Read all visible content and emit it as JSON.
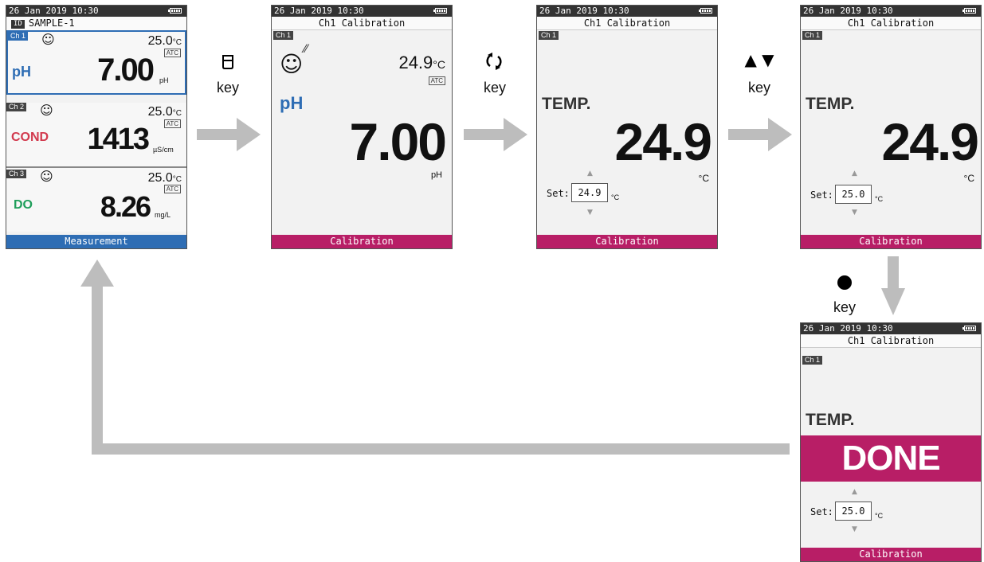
{
  "status_time": "26 Jan 2019  10:30",
  "screen1": {
    "id_tag": "ID",
    "sample": "SAMPLE-1",
    "channels": [
      {
        "tag": "Ch 1",
        "temp": "25.0",
        "temp_unit": "°C",
        "atc": "ATC",
        "param": "pH",
        "value": "7.00",
        "unit": "pH",
        "color": "#2e6db4"
      },
      {
        "tag": "Ch 2",
        "temp": "25.0",
        "temp_unit": "°C",
        "atc": "ATC",
        "param": "COND",
        "value": "1413",
        "unit": "µS/cm",
        "color": "#d23a4e"
      },
      {
        "tag": "Ch 3",
        "temp": "25.0",
        "temp_unit": "°C",
        "atc": "ATC",
        "param": "DO",
        "value": "8.26",
        "unit": "mg/L",
        "color": "#1e9e5a"
      }
    ],
    "footer": "Measurement"
  },
  "screen2": {
    "title": "Ch1 Calibration",
    "tag": "Ch 1",
    "temp": "24.9",
    "temp_unit": "°C",
    "atc": "ATC",
    "param": "pH",
    "value": "7.00",
    "unit": "pH",
    "footer": "Calibration"
  },
  "screen3": {
    "title": "Ch1 Calibration",
    "tag": "Ch 1",
    "label": "TEMP.",
    "value": "24.9",
    "unit": "°C",
    "set_label": "Set:",
    "set_value": "24.9",
    "set_unit": "°C",
    "footer": "Calibration"
  },
  "screen4": {
    "title": "Ch1 Calibration",
    "tag": "Ch 1",
    "label": "TEMP.",
    "value": "24.9",
    "unit": "°C",
    "set_label": "Set:",
    "set_value": "25.0",
    "set_unit": "°C",
    "footer": "Calibration"
  },
  "screen5": {
    "title": "Ch1 Calibration",
    "tag": "Ch 1",
    "label": "TEMP.",
    "done": "DONE",
    "set_label": "Set:",
    "set_value": "25.0",
    "set_unit": "°C",
    "footer": "Calibration"
  },
  "keys": {
    "cal": {
      "icon": "beaker-icon",
      "label": "key"
    },
    "enter": {
      "icon": "rotate-arrows-icon",
      "label": "key"
    },
    "updown": {
      "icon": "up-down-triangles-icon",
      "label": "key"
    },
    "confirm": {
      "icon": "dot-icon",
      "label": "key"
    }
  },
  "colors": {
    "measurement": "#2e6db4",
    "calibration": "#b81e66",
    "arrow": "#bdbdbd"
  }
}
